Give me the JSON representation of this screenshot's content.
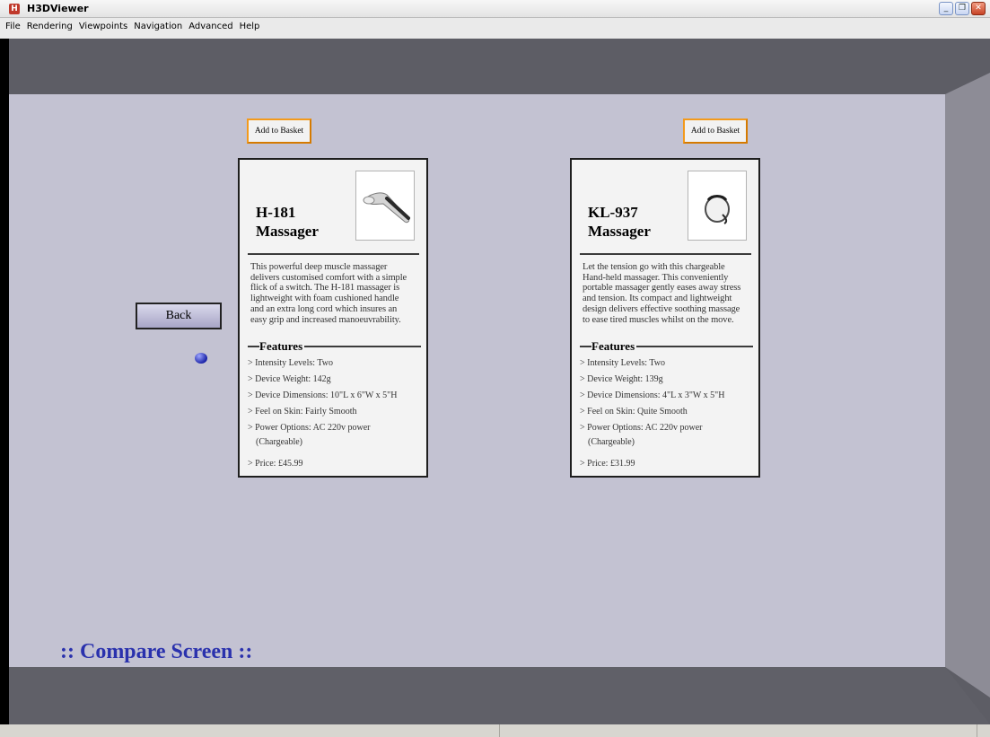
{
  "window": {
    "app_icon": "h3d-app-icon",
    "title": "H3DViewer",
    "controls": [
      {
        "name": "minimize",
        "glyph": "_"
      },
      {
        "name": "restore",
        "glyph": "❐"
      },
      {
        "name": "close",
        "glyph": "✕"
      }
    ]
  },
  "menu": [
    "File",
    "Rendering",
    "Viewpoints",
    "Navigation",
    "Advanced",
    "Help"
  ],
  "scene": {
    "back_label": "Back",
    "compare_title": ":: Compare Screen ::",
    "colors": {
      "wall": "#c3c2d2",
      "ceiling": "#5b5b63",
      "floor": "#5f5f67",
      "side_wall": "#8d8c96",
      "accent_text": "#2a31ad",
      "basket_border": "#f39a1c"
    }
  },
  "products": [
    {
      "basket_label": "Add to Basket",
      "name_line1": "H-181",
      "name_line2": "Massager",
      "image_icon": "handheld-massager-image",
      "description": [
        "This powerful deep muscle massager",
        "delivers customised comfort with a simple",
        "flick of a switch. The H-181 massager is",
        "lightweight with foam cushioned handle",
        "and an extra long cord which insures an",
        "easy grip and increased manoeuvrability."
      ],
      "features_heading": "Features",
      "features": [
        "> Intensity Levels: Two",
        "> Device Weight: 142g",
        "> Device Dimensions: 10\"L x 6\"W x 5\"H",
        "> Feel on Skin: Fairly Smooth",
        "> Power Options: AC 220v power",
        "(Chargeable)"
      ],
      "price": "> Price: £45.99"
    },
    {
      "basket_label": "Add to Basket",
      "name_line1": "KL-937",
      "name_line2": "Massager",
      "image_icon": "compact-massager-image",
      "description": [
        "Let the tension go with this chargeable",
        "Hand-held massager. This conveniently",
        "portable massager gently eases away stress",
        "and tension. Its compact and lightweight",
        "design delivers effective soothing massage",
        "to ease tired muscles whilst on the move."
      ],
      "features_heading": "Features",
      "features": [
        "> Intensity Levels: Two",
        "> Device Weight: 139g",
        "> Device Dimensions: 4\"L x 3\"W x 5\"H",
        "> Feel on Skin: Quite Smooth",
        "> Power Options: AC 220v power",
        "(Chargeable)"
      ],
      "price": "> Price: £31.99"
    }
  ]
}
